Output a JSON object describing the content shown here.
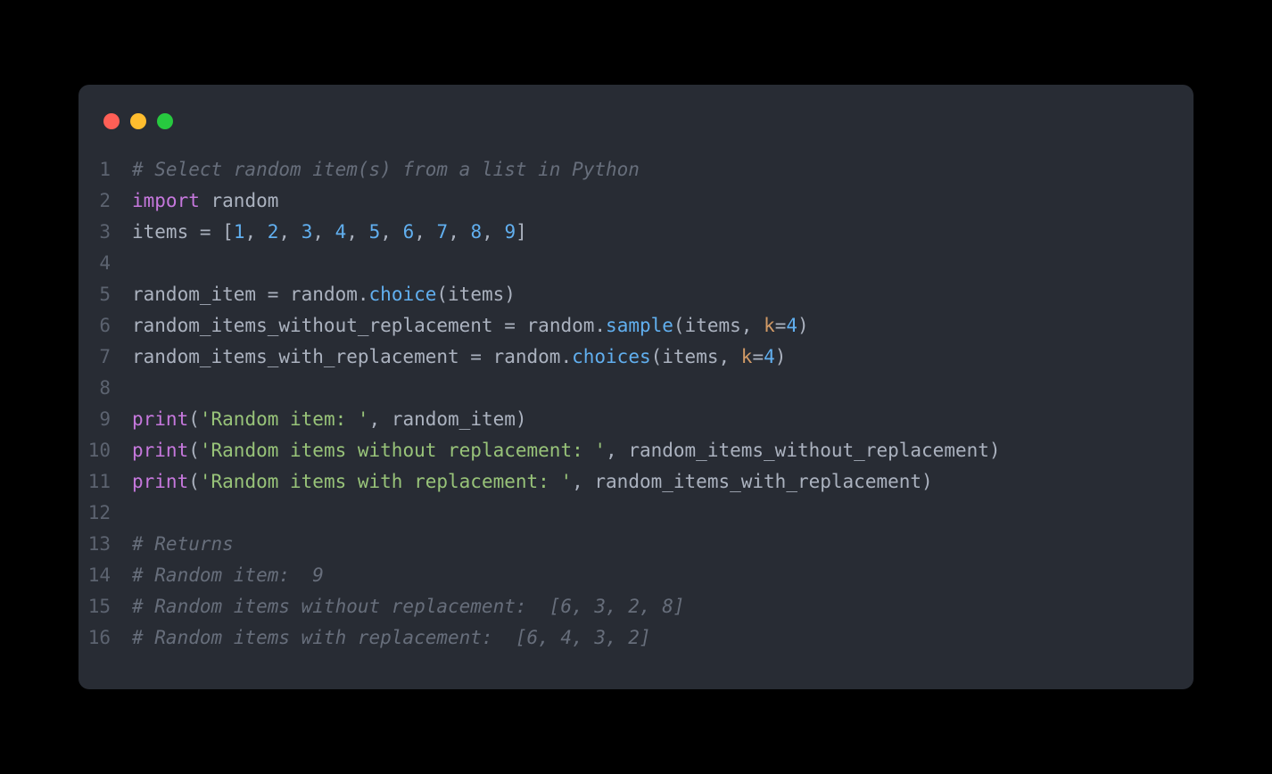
{
  "window": {
    "dots": [
      "red",
      "yellow",
      "green"
    ]
  },
  "lines": [
    {
      "n": "1",
      "tokens": [
        [
          "comment",
          "# Select random item(s) from a list in Python"
        ]
      ]
    },
    {
      "n": "2",
      "tokens": [
        [
          "keyword",
          "import"
        ],
        [
          "plain",
          " "
        ],
        [
          "module",
          "random"
        ]
      ]
    },
    {
      "n": "3",
      "tokens": [
        [
          "plain",
          "items "
        ],
        [
          "op",
          "="
        ],
        [
          "plain",
          " ["
        ],
        [
          "num",
          "1"
        ],
        [
          "punct",
          ", "
        ],
        [
          "num",
          "2"
        ],
        [
          "punct",
          ", "
        ],
        [
          "num",
          "3"
        ],
        [
          "punct",
          ", "
        ],
        [
          "num",
          "4"
        ],
        [
          "punct",
          ", "
        ],
        [
          "num",
          "5"
        ],
        [
          "punct",
          ", "
        ],
        [
          "num",
          "6"
        ],
        [
          "punct",
          ", "
        ],
        [
          "num",
          "7"
        ],
        [
          "punct",
          ", "
        ],
        [
          "num",
          "8"
        ],
        [
          "punct",
          ", "
        ],
        [
          "num",
          "9"
        ],
        [
          "plain",
          "]"
        ]
      ]
    },
    {
      "n": "4",
      "tokens": []
    },
    {
      "n": "5",
      "tokens": [
        [
          "plain",
          "random_item "
        ],
        [
          "op",
          "="
        ],
        [
          "plain",
          " random."
        ],
        [
          "func",
          "choice"
        ],
        [
          "plain",
          "(items)"
        ]
      ]
    },
    {
      "n": "6",
      "tokens": [
        [
          "plain",
          "random_items_without_replacement "
        ],
        [
          "op",
          "="
        ],
        [
          "plain",
          " random."
        ],
        [
          "func",
          "sample"
        ],
        [
          "plain",
          "(items, "
        ],
        [
          "kwarg",
          "k"
        ],
        [
          "op",
          "="
        ],
        [
          "num",
          "4"
        ],
        [
          "plain",
          ")"
        ]
      ]
    },
    {
      "n": "7",
      "tokens": [
        [
          "plain",
          "random_items_with_replacement "
        ],
        [
          "op",
          "="
        ],
        [
          "plain",
          " random."
        ],
        [
          "func",
          "choices"
        ],
        [
          "plain",
          "(items, "
        ],
        [
          "kwarg",
          "k"
        ],
        [
          "op",
          "="
        ],
        [
          "num",
          "4"
        ],
        [
          "plain",
          ")"
        ]
      ]
    },
    {
      "n": "8",
      "tokens": []
    },
    {
      "n": "9",
      "tokens": [
        [
          "builtin",
          "print"
        ],
        [
          "plain",
          "("
        ],
        [
          "str",
          "'Random item: '"
        ],
        [
          "plain",
          ", random_item)"
        ]
      ]
    },
    {
      "n": "10",
      "tokens": [
        [
          "builtin",
          "print"
        ],
        [
          "plain",
          "("
        ],
        [
          "str",
          "'Random items without replacement: '"
        ],
        [
          "plain",
          ", random_items_without_replacement)"
        ]
      ]
    },
    {
      "n": "11",
      "tokens": [
        [
          "builtin",
          "print"
        ],
        [
          "plain",
          "("
        ],
        [
          "str",
          "'Random items with replacement: '"
        ],
        [
          "plain",
          ", random_items_with_replacement)"
        ]
      ]
    },
    {
      "n": "12",
      "tokens": []
    },
    {
      "n": "13",
      "tokens": [
        [
          "comment",
          "# Returns"
        ]
      ]
    },
    {
      "n": "14",
      "tokens": [
        [
          "comment",
          "# Random item:  9"
        ]
      ]
    },
    {
      "n": "15",
      "tokens": [
        [
          "comment",
          "# Random items without replacement:  [6, 3, 2, 8]"
        ]
      ]
    },
    {
      "n": "16",
      "tokens": [
        [
          "comment",
          "# Random items with replacement:  [6, 4, 3, 2]"
        ]
      ]
    }
  ]
}
